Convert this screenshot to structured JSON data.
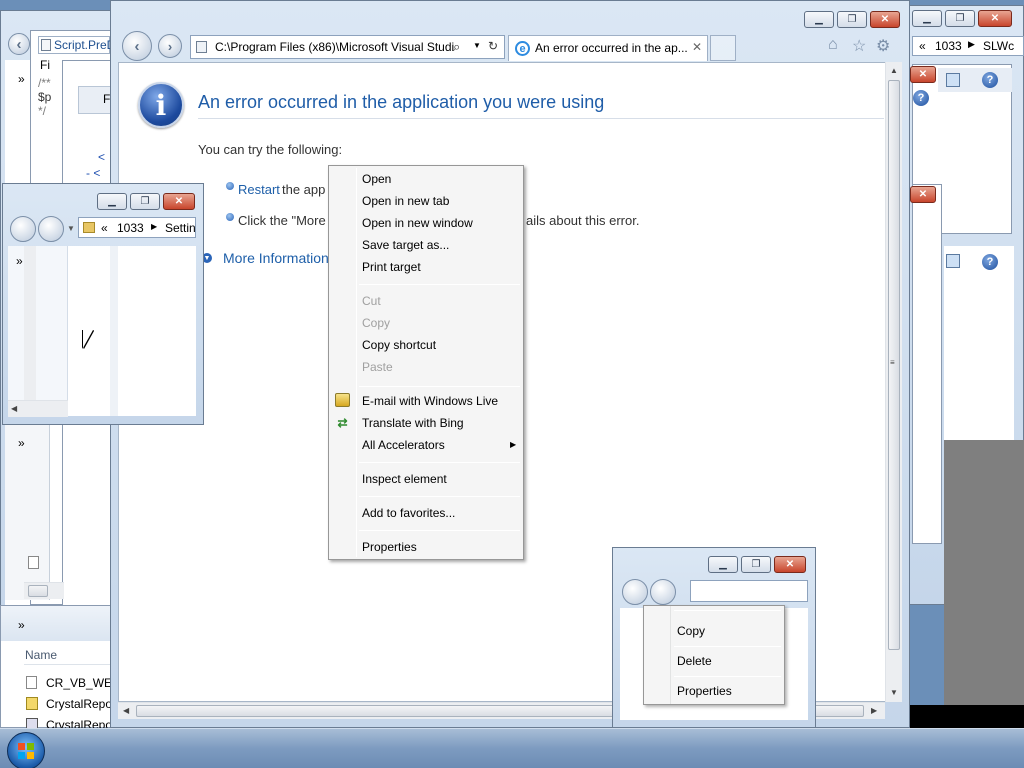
{
  "ie": {
    "address": "C:\\Program Files (x86)\\Microsoft Visual Studi",
    "tab_title": "An error occurred in the ap...",
    "error_title": "An error occurred in the application you were using",
    "try_text": "You can try the following:",
    "bullet1_link": "Restart",
    "bullet1_rest": " the app",
    "bullet2_prefix": "Click the \"More",
    "bullet2_suffix": "ails about this error.",
    "more_info": "More Information"
  },
  "context_menu": {
    "items": [
      {
        "label": "Open",
        "disabled": false
      },
      {
        "label": "Open in new tab",
        "disabled": false
      },
      {
        "label": "Open in new window",
        "disabled": false
      },
      {
        "label": "Save target as...",
        "disabled": false
      },
      {
        "label": "Print target",
        "disabled": false
      },
      {
        "label": "Cut",
        "disabled": true
      },
      {
        "label": "Copy",
        "disabled": true
      },
      {
        "label": "Copy shortcut",
        "disabled": false
      },
      {
        "label": "Paste",
        "disabled": true
      },
      {
        "label": "E-mail with Windows Live",
        "disabled": false
      },
      {
        "label": "Translate with Bing",
        "disabled": false
      },
      {
        "label": "All Accelerators",
        "disabled": false
      },
      {
        "label": "Inspect element",
        "disabled": false
      },
      {
        "label": "Add to favorites...",
        "disabled": false
      },
      {
        "label": "Properties",
        "disabled": false
      }
    ]
  },
  "explorer_small": {
    "breadcrumb_sep": "«",
    "folder": "1033",
    "next": "Settin"
  },
  "explorer_right": {
    "breadcrumb_sep": "«",
    "folder": "1033",
    "next": "SLWc"
  },
  "bottom_menu": {
    "items": [
      "Copy",
      "Delete",
      "Properties"
    ]
  },
  "background_windows": {
    "script_tab": "Script.PreD",
    "fi": "Fi",
    "f2": "F",
    "name_header": "Name",
    "file1": "CR_VB_WEB",
    "file2": "CrystalRepo",
    "file3": "CrystalRepo",
    "chevrons": "»",
    "code_line1": "/**",
    "code_line2": "$p",
    "code_line3": "*/",
    "tag1": "<",
    "tag2": "- <"
  },
  "colors": {
    "link": "#1e5fa9",
    "heading": "#1f5da8",
    "taskbar": "#7d9bc0"
  }
}
